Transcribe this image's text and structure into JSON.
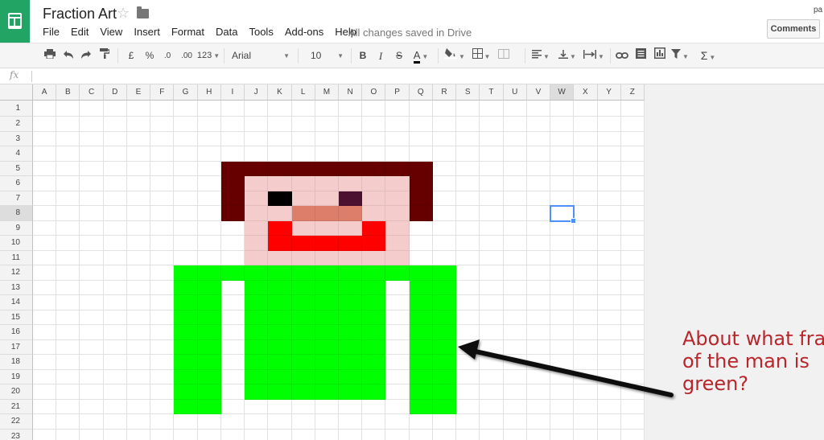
{
  "app": {
    "name": "Google Sheets"
  },
  "document": {
    "title": "Fraction Art",
    "save_status": "All changes saved in Drive"
  },
  "menu": [
    "File",
    "Edit",
    "View",
    "Insert",
    "Format",
    "Data",
    "Tools",
    "Add-ons",
    "Help"
  ],
  "user": {
    "name_fragment": "pa"
  },
  "comments_button": {
    "label": "Comments"
  },
  "toolbar": {
    "currency_label": "£",
    "percent_label": "%",
    "decimal_decrease_label": ".0",
    "decimal_increase_label": ".00",
    "number_format_label": "123",
    "font_family": "Arial",
    "font_size": "10",
    "bold_label": "B",
    "italic_label": "I",
    "strikethrough_label": "S",
    "text_color_label": "A",
    "functions_label": "Σ"
  },
  "formula_bar": {
    "fx_label": "fx",
    "value": ""
  },
  "sheet": {
    "columns": [
      "A",
      "B",
      "C",
      "D",
      "E",
      "F",
      "G",
      "H",
      "I",
      "J",
      "K",
      "L",
      "M",
      "N",
      "O",
      "P",
      "Q",
      "R",
      "S",
      "T",
      "U",
      "V",
      "W",
      "X",
      "Y",
      "Z"
    ],
    "rows": [
      "1",
      "2",
      "3",
      "4",
      "5",
      "6",
      "7",
      "8",
      "9",
      "10",
      "11",
      "12",
      "13",
      "14",
      "15",
      "16",
      "17",
      "18",
      "19",
      "20",
      "21",
      "22",
      "23"
    ],
    "selected_column": "W",
    "selected_row": "8",
    "active_cell": "W8",
    "colors": {
      "hair": "#660000",
      "skin": "#f4cccc",
      "eye_left": "#000000",
      "eye_right": "#4c1130",
      "nose": "#dd7e6b",
      "mouth": "#ff0000",
      "shirt": "#00ff00"
    },
    "fills": [
      {
        "row": 5,
        "cols": "I-Q",
        "color": "hair"
      },
      {
        "row": 6,
        "cols": "I",
        "color": "hair"
      },
      {
        "row": 6,
        "cols": "J-P",
        "color": "skin"
      },
      {
        "row": 6,
        "cols": "Q",
        "color": "hair"
      },
      {
        "row": 7,
        "cols": "I",
        "color": "hair"
      },
      {
        "row": 7,
        "cols": "J",
        "color": "skin"
      },
      {
        "row": 7,
        "cols": "K",
        "color": "eye_left"
      },
      {
        "row": 7,
        "cols": "L-M",
        "color": "skin"
      },
      {
        "row": 7,
        "cols": "N",
        "color": "eye_right"
      },
      {
        "row": 7,
        "cols": "O-P",
        "color": "skin"
      },
      {
        "row": 7,
        "cols": "Q",
        "color": "hair"
      },
      {
        "row": 8,
        "cols": "I",
        "color": "hair"
      },
      {
        "row": 8,
        "cols": "J-K",
        "color": "skin"
      },
      {
        "row": 8,
        "cols": "L-N",
        "color": "nose"
      },
      {
        "row": 8,
        "cols": "O-P",
        "color": "skin"
      },
      {
        "row": 8,
        "cols": "Q",
        "color": "hair"
      },
      {
        "row": 9,
        "cols": "J",
        "color": "skin"
      },
      {
        "row": 9,
        "cols": "K",
        "color": "mouth"
      },
      {
        "row": 9,
        "cols": "L-N",
        "color": "skin"
      },
      {
        "row": 9,
        "cols": "O",
        "color": "mouth"
      },
      {
        "row": 9,
        "cols": "P",
        "color": "skin"
      },
      {
        "row": 10,
        "cols": "J",
        "color": "skin"
      },
      {
        "row": 10,
        "cols": "K-O",
        "color": "mouth"
      },
      {
        "row": 10,
        "cols": "P",
        "color": "skin"
      },
      {
        "row": 11,
        "cols": "J-P",
        "color": "skin"
      },
      {
        "row": 12,
        "cols": "G-R",
        "color": "shirt"
      },
      {
        "row": 13,
        "cols": "G-H",
        "color": "shirt"
      },
      {
        "row": 13,
        "cols": "J-O",
        "color": "shirt"
      },
      {
        "row": 13,
        "cols": "Q-R",
        "color": "shirt"
      },
      {
        "row": 14,
        "cols": "G-H",
        "color": "shirt"
      },
      {
        "row": 14,
        "cols": "J-O",
        "color": "shirt"
      },
      {
        "row": 14,
        "cols": "Q-R",
        "color": "shirt"
      },
      {
        "row": 15,
        "cols": "G-H",
        "color": "shirt"
      },
      {
        "row": 15,
        "cols": "J-O",
        "color": "shirt"
      },
      {
        "row": 15,
        "cols": "Q-R",
        "color": "shirt"
      },
      {
        "row": 16,
        "cols": "G-H",
        "color": "shirt"
      },
      {
        "row": 16,
        "cols": "J-O",
        "color": "shirt"
      },
      {
        "row": 16,
        "cols": "Q-R",
        "color": "shirt"
      },
      {
        "row": 17,
        "cols": "G-H",
        "color": "shirt"
      },
      {
        "row": 17,
        "cols": "J-O",
        "color": "shirt"
      },
      {
        "row": 17,
        "cols": "Q-R",
        "color": "shirt"
      },
      {
        "row": 18,
        "cols": "G-H",
        "color": "shirt"
      },
      {
        "row": 18,
        "cols": "J-O",
        "color": "shirt"
      },
      {
        "row": 18,
        "cols": "Q-R",
        "color": "shirt"
      },
      {
        "row": 19,
        "cols": "G-H",
        "color": "shirt"
      },
      {
        "row": 19,
        "cols": "J-O",
        "color": "shirt"
      },
      {
        "row": 19,
        "cols": "Q-R",
        "color": "shirt"
      },
      {
        "row": 20,
        "cols": "G-H",
        "color": "shirt"
      },
      {
        "row": 20,
        "cols": "J-O",
        "color": "shirt"
      },
      {
        "row": 20,
        "cols": "Q-R",
        "color": "shirt"
      },
      {
        "row": 21,
        "cols": "G-H",
        "color": "shirt"
      },
      {
        "row": 21,
        "cols": "Q-R",
        "color": "shirt"
      }
    ]
  },
  "annotation": {
    "lines": [
      "About what fraction",
      "of the man is",
      "green?"
    ],
    "color": "#b8262b",
    "arrow_color": "#111111"
  }
}
